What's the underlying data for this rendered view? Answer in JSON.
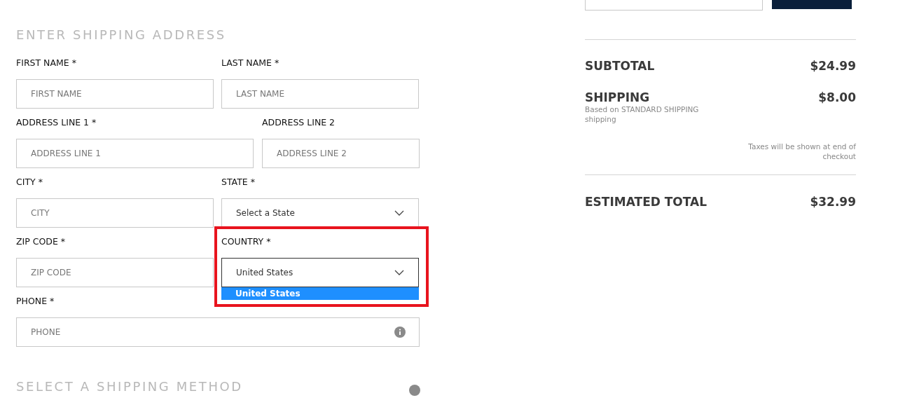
{
  "shipping_address": {
    "heading": "ENTER SHIPPING ADDRESS",
    "rows": [
      [
        {
          "kind": "text",
          "label": "FIRST NAME *",
          "placeholder": "FIRST NAME"
        },
        {
          "kind": "text",
          "label": "LAST NAME *",
          "placeholder": "LAST NAME"
        }
      ],
      [
        {
          "kind": "text",
          "label": "ADDRESS LINE 1 *",
          "placeholder": "ADDRESS LINE 1"
        },
        {
          "kind": "text",
          "label": "ADDRESS LINE 2",
          "placeholder": "ADDRESS LINE 2"
        }
      ],
      [
        {
          "kind": "text",
          "label": "CITY *",
          "placeholder": "CITY"
        },
        {
          "kind": "select",
          "label": "STATE *",
          "value": "Select a State",
          "open": false
        }
      ],
      [
        {
          "kind": "text",
          "label": "ZIP CODE *",
          "placeholder": "ZIP CODE"
        },
        {
          "kind": "select",
          "label": "COUNTRY *",
          "value": "United States",
          "open": true,
          "highlighted": true,
          "options": [
            {
              "label": "United States",
              "selected": true
            }
          ]
        }
      ],
      [
        {
          "kind": "phone",
          "label": "PHONE *",
          "placeholder": "PHONE"
        }
      ]
    ]
  },
  "shipping_method": {
    "heading": "SELECT A SHIPPING METHOD"
  },
  "summary": {
    "lines": [
      {
        "kind": "subtotal",
        "label": "SUBTOTAL",
        "amount": "$24.99"
      },
      {
        "kind": "shipping",
        "label": "SHIPPING",
        "amount": "$8.00",
        "note": "Based on STANDARD SHIPPING shipping"
      }
    ],
    "tax_note": "Taxes will be shown at end of checkout",
    "total": {
      "label": "ESTIMATED TOTAL",
      "amount": "$32.99"
    }
  }
}
